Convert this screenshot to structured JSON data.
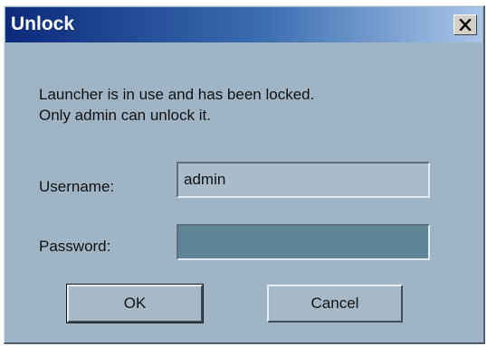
{
  "dialog": {
    "title": "Unlock",
    "close_glyph": "✕",
    "message_line1": "Launcher is in use and has been locked.",
    "message_line2": "Only admin can unlock it.",
    "username_label": "Username:",
    "username_value": "admin",
    "password_label": "Password:",
    "password_value": "",
    "ok_label": "OK",
    "cancel_label": "Cancel"
  },
  "colors": {
    "window_bg": "#9fb4c4",
    "title_start": "#0b2a7a",
    "title_end": "#a9c6e8",
    "password_field_bg": "#5e8697"
  },
  "icons": {
    "close": "close-icon"
  }
}
